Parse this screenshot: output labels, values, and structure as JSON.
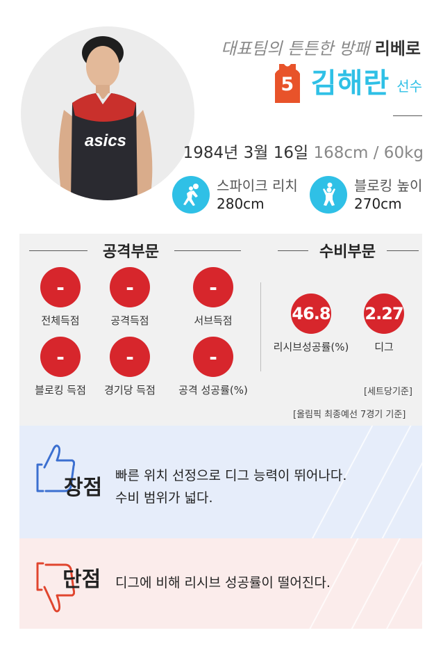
{
  "header": {
    "subtitle_lead": "대표팀의 튼튼한 방패",
    "subtitle_role": "리베로",
    "jersey_number": "5",
    "player_name": "김해란",
    "player_title": "선수",
    "birth": "1984년 3월 16일",
    "body": "168cm / 60kg",
    "photo_text": "asics"
  },
  "skills": [
    {
      "icon": "spike-player-icon",
      "label": "스파이크 리치",
      "value": "280cm"
    },
    {
      "icon": "block-player-icon",
      "label": "블로킹 높이",
      "value": "270cm"
    }
  ],
  "attack": {
    "title": "공격부문",
    "items": [
      {
        "value": "-",
        "label": "전체득점"
      },
      {
        "value": "-",
        "label": "공격득점"
      },
      {
        "value": "-",
        "label": "서브득점"
      },
      {
        "value": "-",
        "label": "블로킹 득점"
      },
      {
        "value": "-",
        "label": "경기당 득점"
      },
      {
        "value": "-",
        "label": "공격 성공률(%)"
      }
    ]
  },
  "defense": {
    "title": "수비부문",
    "items": [
      {
        "value": "46.8",
        "label": "리시브성공률(%)"
      },
      {
        "value": "2.27",
        "label": "디그"
      }
    ],
    "note": "[세트당기준]"
  },
  "footnote": "[올림픽 최종예선 7경기 기준]",
  "pros": {
    "title": "장점",
    "lines": [
      "빠른 위치 선정으로 디그 능력이 뛰어나다.",
      "수비 범위가 넓다."
    ]
  },
  "cons": {
    "title": "단점",
    "lines": [
      "디그에 비해 리시브 성공률이 떨어진다."
    ]
  },
  "colors": {
    "accent": "#2fc0e6",
    "badge": "#d7262c",
    "jersey": "#e8532a",
    "pros_bg": "#e6edfa",
    "cons_bg": "#fbeceb",
    "pros_icon": "#3b6fd0",
    "cons_icon": "#e0452e"
  }
}
